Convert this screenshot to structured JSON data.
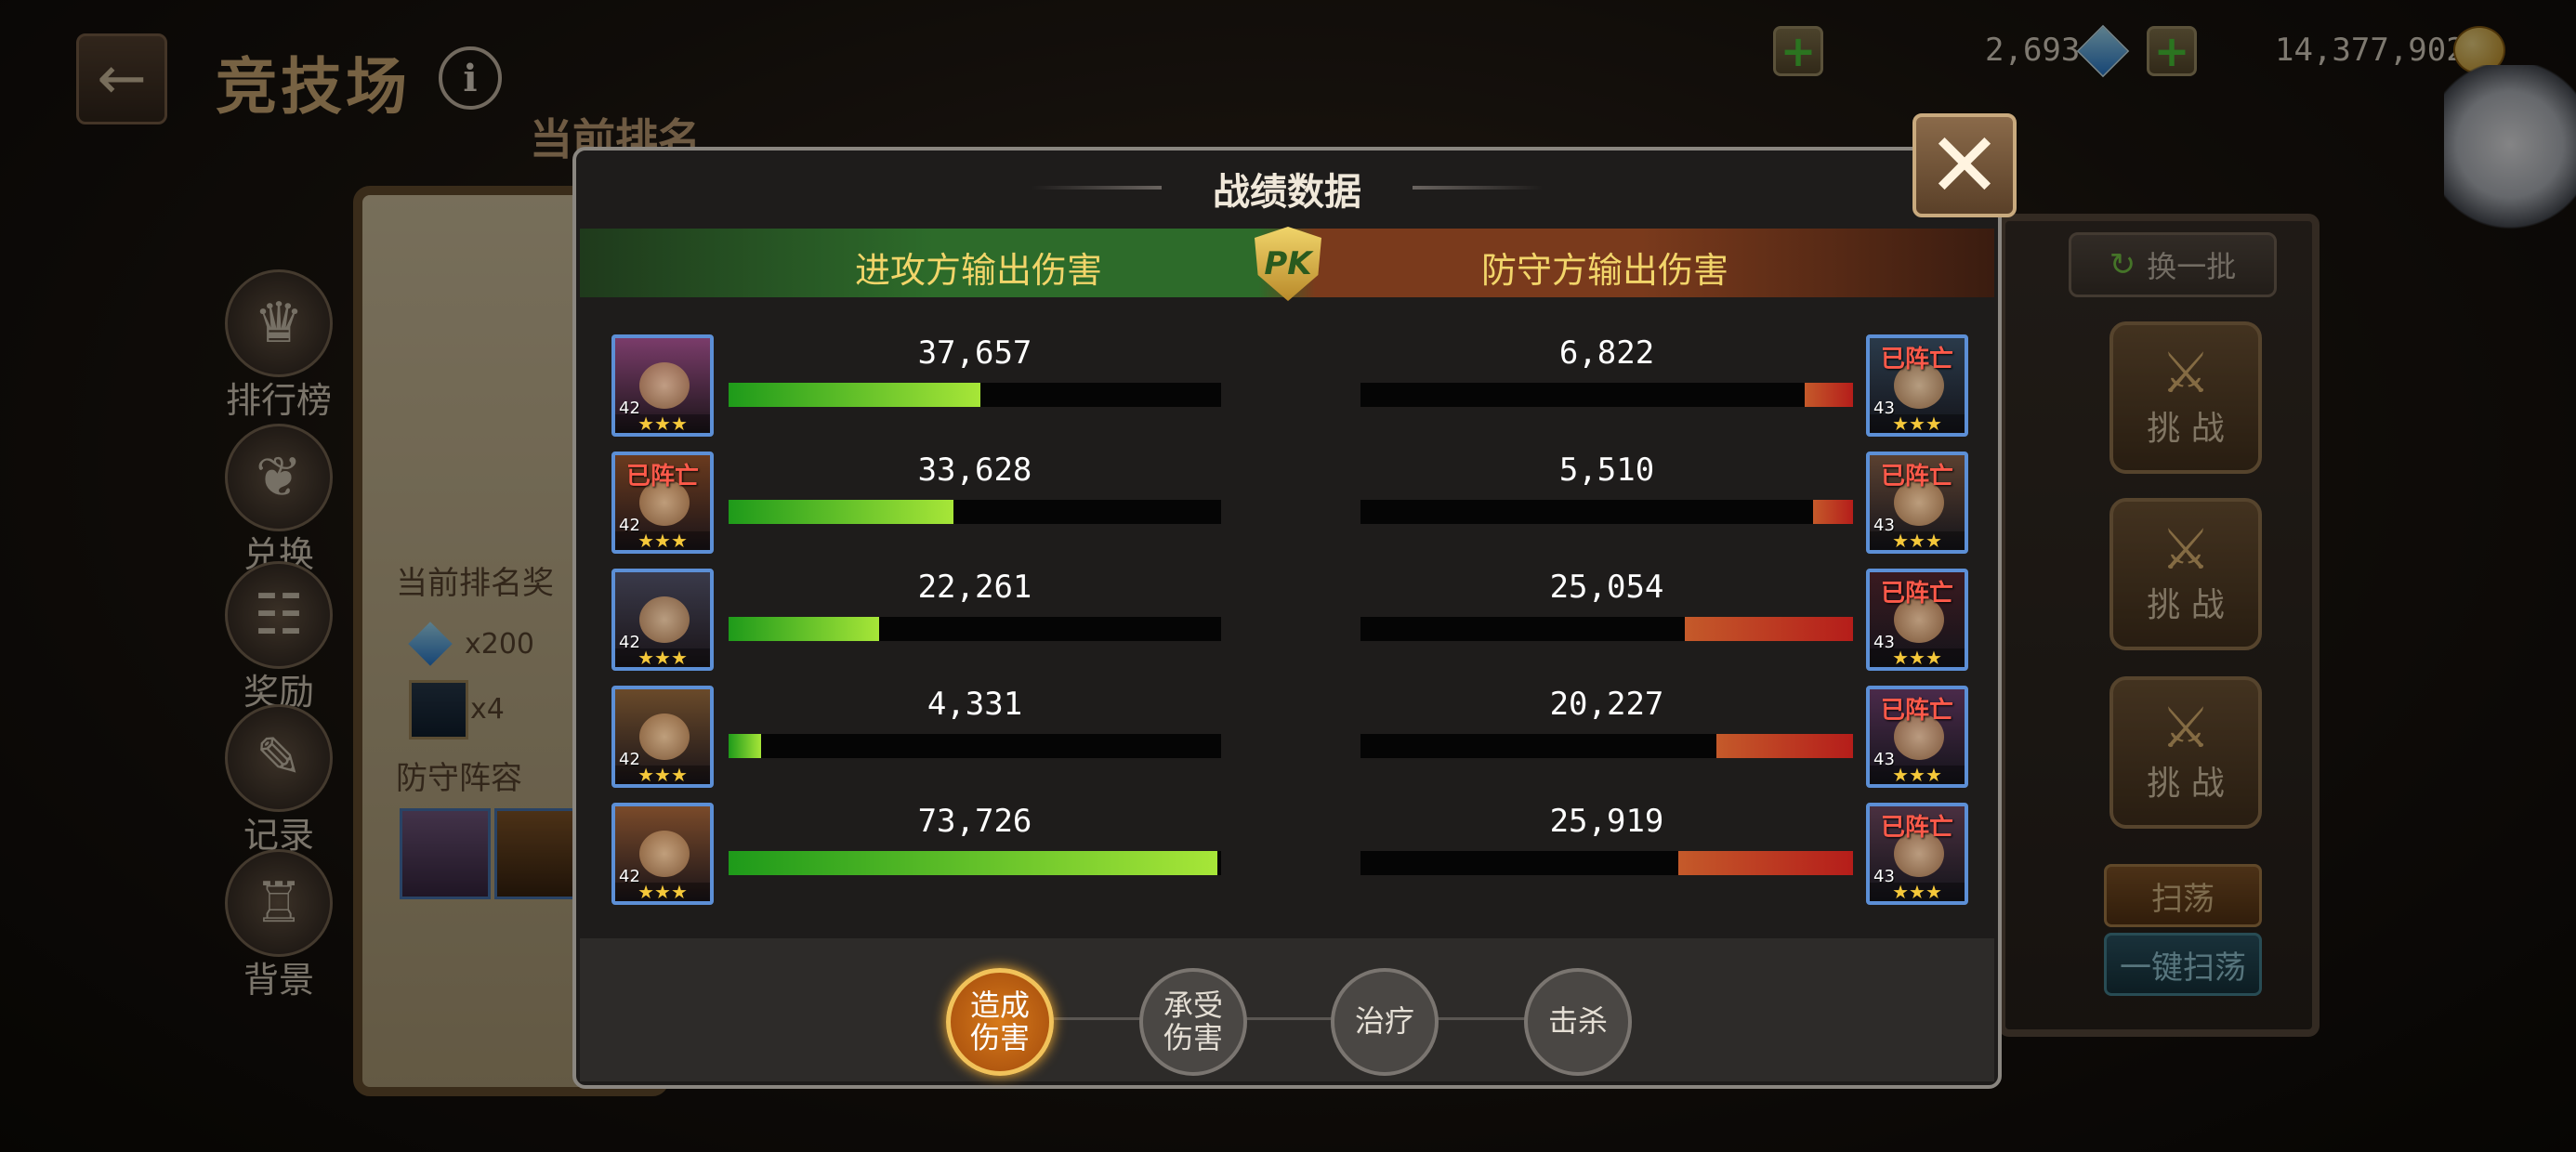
{
  "header": {
    "back_icon": "back-arrow-icon",
    "title": "竞技场",
    "info_icon": "info-icon",
    "rank_label": "当前排名"
  },
  "currencies": {
    "diamond": "2,693",
    "gold": "14,377,902"
  },
  "side_menu": [
    {
      "label": "排行榜",
      "icon": "ranking-icon"
    },
    {
      "label": "兑换",
      "icon": "exchange-icon"
    },
    {
      "label": "奖励",
      "icon": "reward-icon"
    },
    {
      "label": "记录",
      "icon": "record-icon"
    },
    {
      "label": "背景",
      "icon": "background-icon"
    }
  ],
  "left_panel": {
    "reward_label": "当前排名奖",
    "diamond_count": "x200",
    "item_count": "x4",
    "lineup_label": "防守阵容"
  },
  "right_panel": {
    "swap_label": "换一批",
    "challenge_label": "挑 战",
    "sweep_label": "扫荡",
    "one_click_sweep_label": "一键扫荡"
  },
  "modal": {
    "title": "战绩数据",
    "attack_header": "进攻方输出伤害",
    "defend_header": "防守方输出伤害",
    "pk_label": "PK",
    "close_icon": "close-icon",
    "max_value": 73726,
    "attackers": [
      {
        "value": "37,657",
        "raw": 37657,
        "level": "42",
        "dead": false,
        "dead_label": "",
        "stars": "★★★"
      },
      {
        "value": "33,628",
        "raw": 33628,
        "level": "42",
        "dead": true,
        "dead_label": "已阵亡",
        "stars": "★★★"
      },
      {
        "value": "22,261",
        "raw": 22261,
        "level": "42",
        "dead": false,
        "dead_label": "",
        "stars": "★★★"
      },
      {
        "value": "4,331",
        "raw": 4331,
        "level": "42",
        "dead": false,
        "dead_label": "",
        "stars": "★★★"
      },
      {
        "value": "73,726",
        "raw": 73726,
        "level": "42",
        "dead": false,
        "dead_label": "",
        "stars": "★★★"
      }
    ],
    "defenders": [
      {
        "value": "6,822",
        "raw": 6822,
        "level": "43",
        "dead": true,
        "dead_label": "已阵亡",
        "stars": "★★★"
      },
      {
        "value": "5,510",
        "raw": 5510,
        "level": "43",
        "dead": true,
        "dead_label": "已阵亡",
        "stars": "★★★"
      },
      {
        "value": "25,054",
        "raw": 25054,
        "level": "43",
        "dead": true,
        "dead_label": "已阵亡",
        "stars": "★★★"
      },
      {
        "value": "20,227",
        "raw": 20227,
        "level": "43",
        "dead": true,
        "dead_label": "已阵亡",
        "stars": "★★★"
      },
      {
        "value": "25,919",
        "raw": 25919,
        "level": "43",
        "dead": true,
        "dead_label": "已阵亡",
        "stars": "★★★"
      }
    ],
    "tabs": [
      {
        "label": "造成伤害",
        "active": true
      },
      {
        "label": "承受伤害",
        "active": false
      },
      {
        "label": "治疗",
        "active": false
      },
      {
        "label": "击杀",
        "active": false
      }
    ]
  },
  "colors": {
    "attack_bar": "#7fd438",
    "defend_bar": "#c42a1e",
    "accent_gold": "#f2d56a",
    "active_tab": "#d77a1a"
  }
}
